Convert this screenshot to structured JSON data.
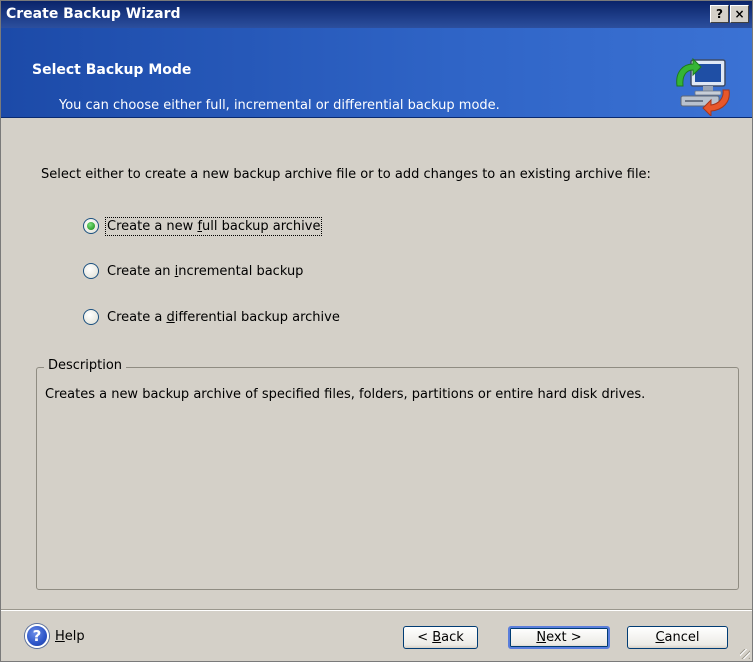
{
  "window": {
    "title": "Create Backup Wizard",
    "help_glyph": "?",
    "close_glyph": "×"
  },
  "header": {
    "title": "Select Backup Mode",
    "subtitle": "You can choose either full, incremental or differential backup mode.",
    "icon": "backup-computer-icon"
  },
  "instruction": "Select either to create a new backup archive file or to add changes to an existing archive file:",
  "options": [
    {
      "pre": "Create a new ",
      "key": "f",
      "post": "ull backup archive",
      "checked": true
    },
    {
      "pre": "Create an ",
      "key": "i",
      "post": "ncremental backup",
      "checked": false
    },
    {
      "pre": "Create a ",
      "key": "d",
      "post": "ifferential backup archive",
      "checked": false
    }
  ],
  "description": {
    "legend": "Description",
    "text": "Creates a new backup archive of specified files, folders, partitions or entire hard disk drives."
  },
  "footer": {
    "help": {
      "key": "H",
      "post": "elp"
    },
    "back": {
      "pre": "< ",
      "key": "B",
      "post": "ack"
    },
    "next": {
      "key": "N",
      "post": "ext >"
    },
    "cancel": {
      "key": "C",
      "post": "ancel"
    }
  },
  "colors": {
    "header_bg": "#2f64c6",
    "titlebar_bg": "#0a246a",
    "radio_checked": "#2ea12e"
  }
}
